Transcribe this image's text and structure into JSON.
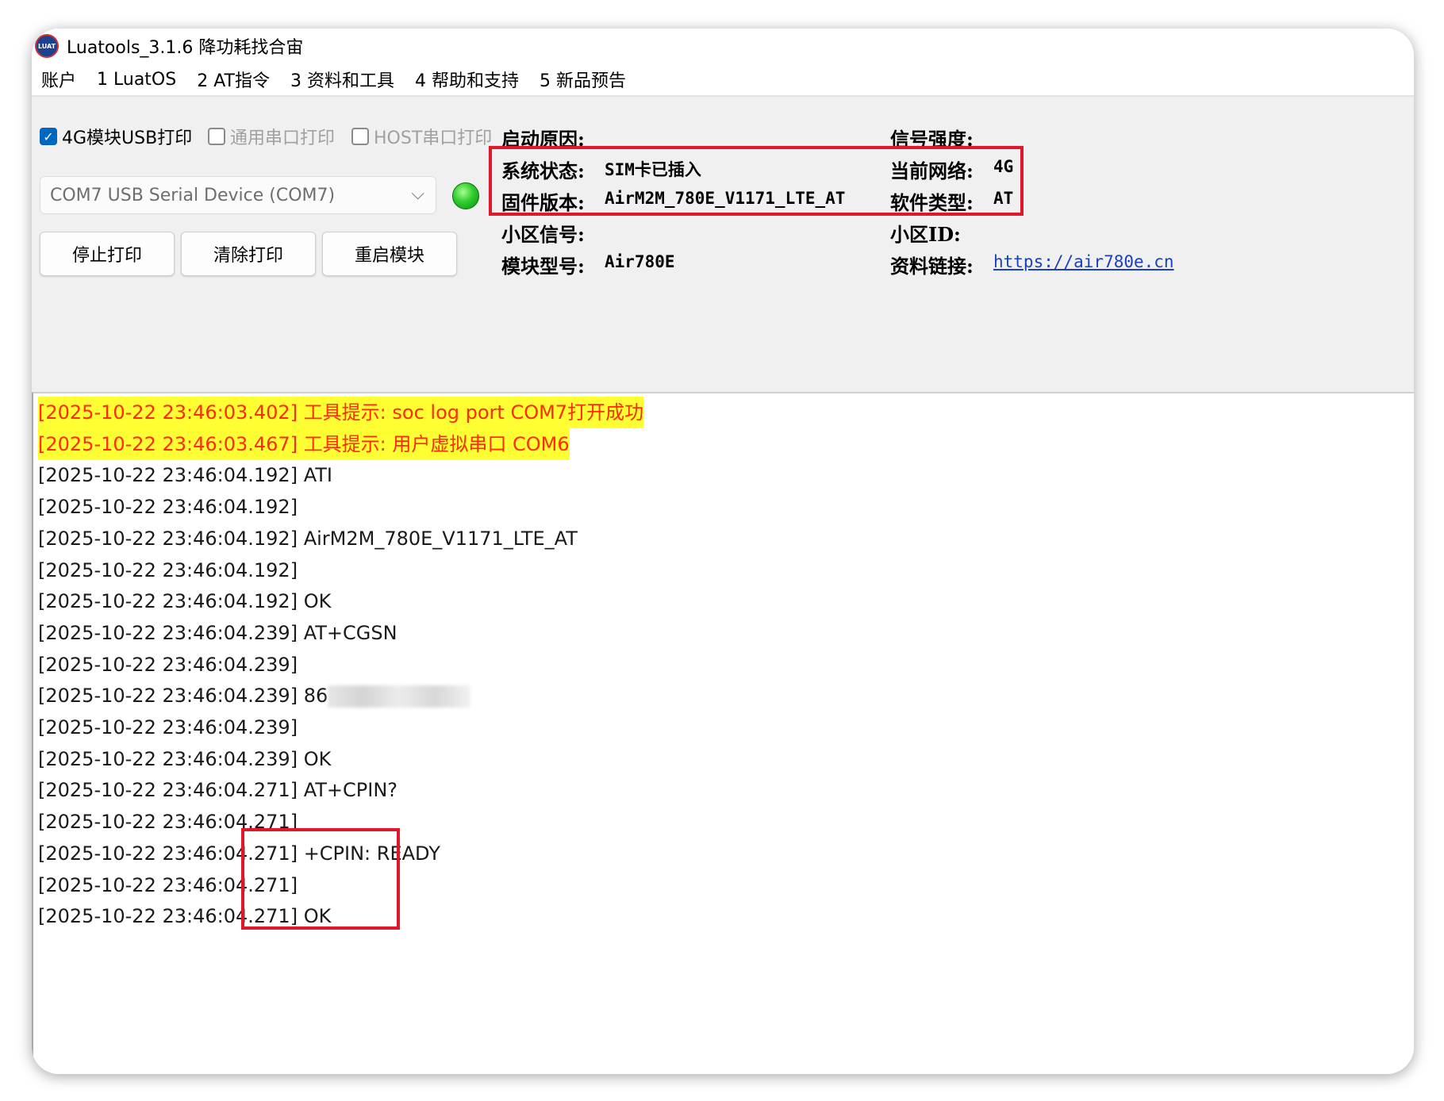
{
  "window": {
    "title": "Luatools_3.1.6 降功耗找合宙",
    "icon_name": "luat-app-icon"
  },
  "menu": [
    "账户",
    "1 LuatOS",
    "2 AT指令",
    "3 资料和工具",
    "4 帮助和支持",
    "5 新品预告"
  ],
  "options": {
    "usb_print": {
      "label": "4G模块USB打印",
      "checked": true
    },
    "serial_print": {
      "label": "通用串口打印",
      "checked": false
    },
    "host_print": {
      "label": "HOST串口打印",
      "checked": false
    }
  },
  "port": {
    "selected": "COM7 USB Serial Device (COM7)",
    "status_color": "#2ecc2e"
  },
  "buttons": {
    "stop": "停止打印",
    "clear": "清除打印",
    "restart": "重启模块"
  },
  "info": {
    "boot_reason_label": "启动原因:",
    "signal_label": "信号强度:",
    "sys_status_label": "系统状态:",
    "sys_status_value": "SIM卡已插入",
    "network_label": "当前网络:",
    "network_value": "4G",
    "firmware_label": "固件版本:",
    "firmware_value": "AirM2M_780E_V1171_LTE_AT",
    "software_label": "软件类型:",
    "software_value": "AT",
    "cell_signal_label": "小区信号:",
    "cell_id_label": "小区ID:",
    "model_label": "模块型号:",
    "model_value": "Air780E",
    "link_label": "资料链接:",
    "link_value": "https://air780e.cn"
  },
  "log": [
    {
      "text": "[2025-10-22 23:46:03.402] 工具提示: soc log port COM7打开成功",
      "type": "warn"
    },
    {
      "text": "[2025-10-22 23:46:03.467] 工具提示: 用户虚拟串口 COM6",
      "type": "warn"
    },
    {
      "text": "[2025-10-22 23:46:04.192] ATI",
      "type": "normal"
    },
    {
      "text": "[2025-10-22 23:46:04.192]",
      "type": "normal"
    },
    {
      "text": "[2025-10-22 23:46:04.192] AirM2M_780E_V1171_LTE_AT",
      "type": "normal"
    },
    {
      "text": "[2025-10-22 23:46:04.192]",
      "type": "normal"
    },
    {
      "text": "[2025-10-22 23:46:04.192] OK",
      "type": "normal"
    },
    {
      "text": "[2025-10-22 23:46:04.239] AT+CGSN",
      "type": "normal"
    },
    {
      "text": "[2025-10-22 23:46:04.239]",
      "type": "normal"
    },
    {
      "text": "[2025-10-22 23:46:04.239] 86",
      "type": "redacted"
    },
    {
      "text": "[2025-10-22 23:46:04.239]",
      "type": "normal"
    },
    {
      "text": "[2025-10-22 23:46:04.239] OK",
      "type": "normal"
    },
    {
      "text": "[2025-10-22 23:46:04.271] AT+CPIN?",
      "type": "normal"
    },
    {
      "text": "[2025-10-22 23:46:04.271]",
      "type": "normal"
    },
    {
      "text": "[2025-10-22 23:46:04.271] +CPIN: READY",
      "type": "normal"
    },
    {
      "text": "[2025-10-22 23:46:04.271]",
      "type": "normal"
    },
    {
      "text": "[2025-10-22 23:46:04.271] OK",
      "type": "normal"
    }
  ],
  "annotation_color": "#e0162b"
}
